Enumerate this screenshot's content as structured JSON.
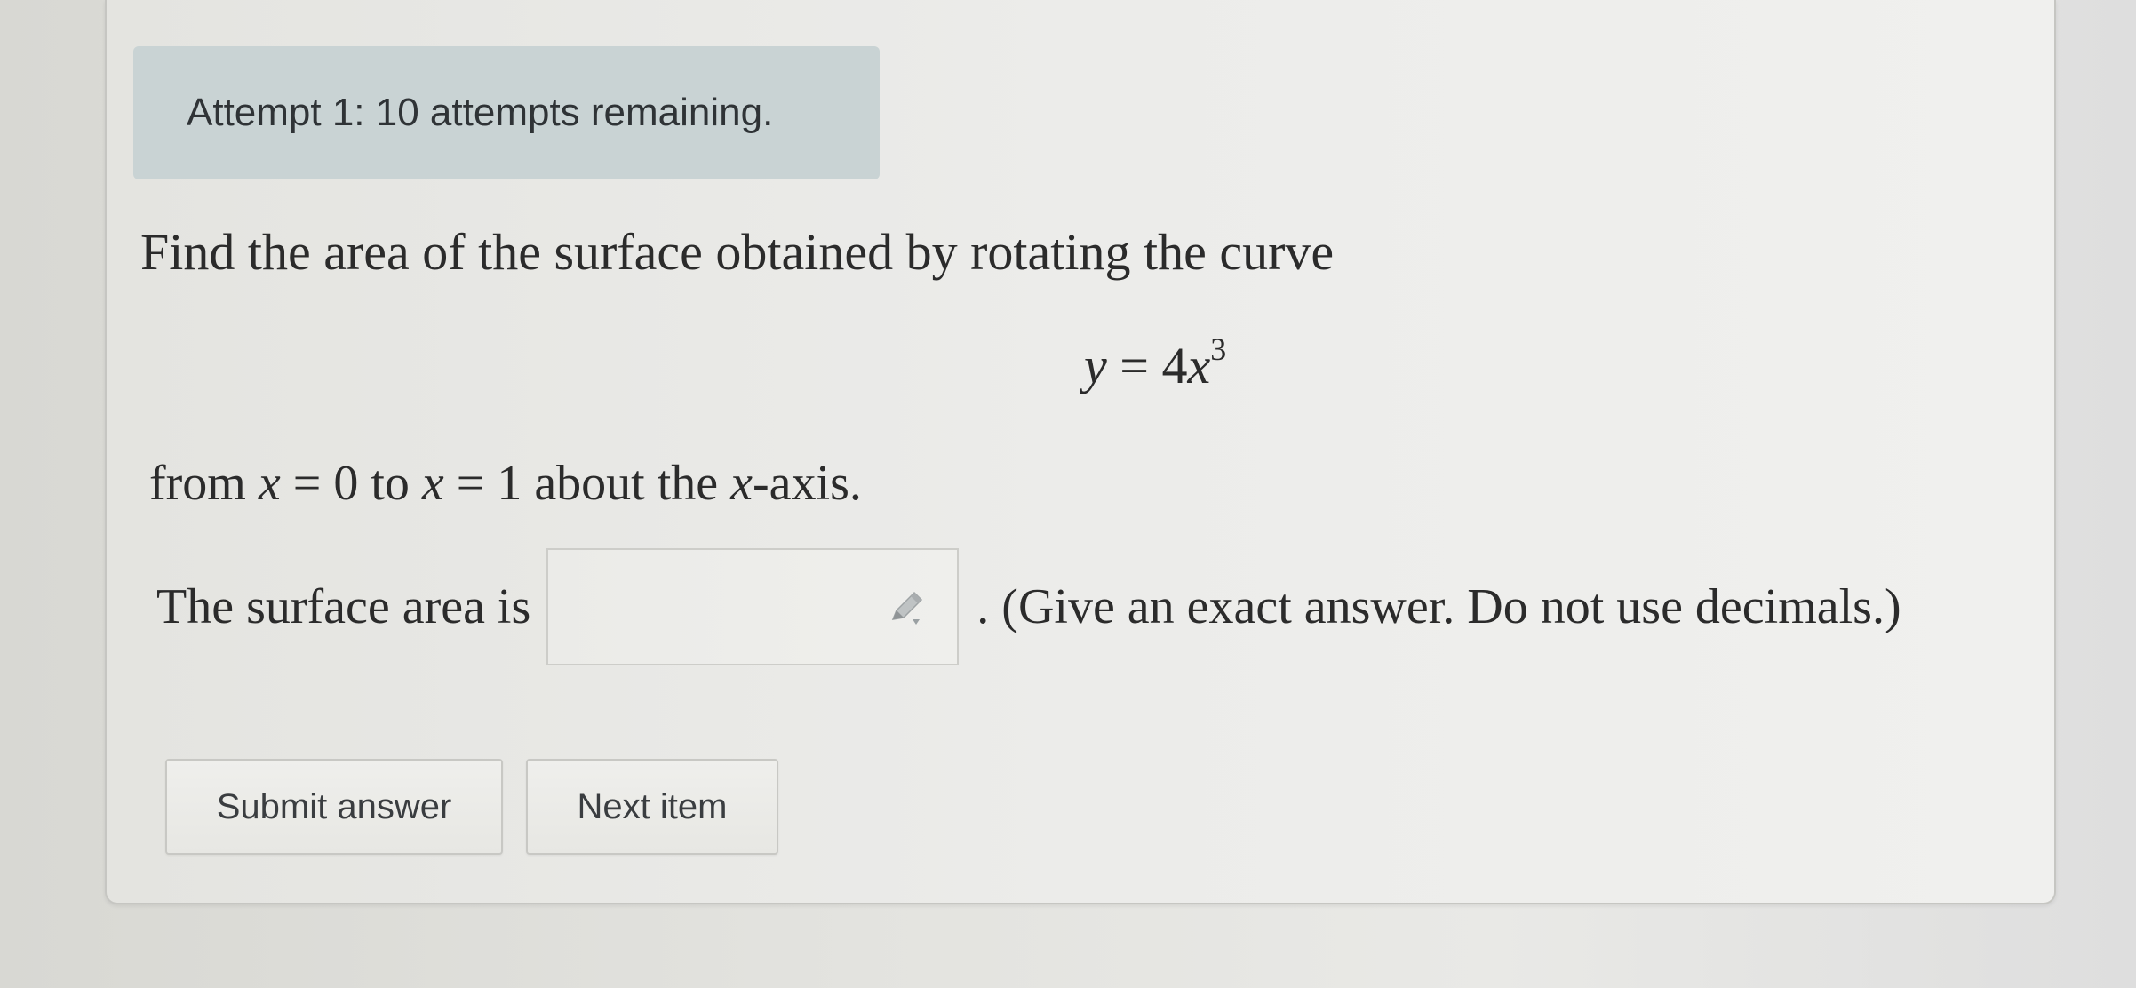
{
  "attempt": {
    "text": "Attempt 1: 10 attempts remaining."
  },
  "question": {
    "prompt": "Find the area of the surface obtained by rotating the curve",
    "equation": {
      "lhs": "y",
      "equals": "=",
      "coefficient": "4",
      "variable": "x",
      "exponent": "3"
    },
    "range": {
      "from_word": "from",
      "var1": "x",
      "eq1": "=",
      "start": "0",
      "to_word": "to",
      "var2": "x",
      "eq2": "=",
      "end": "1",
      "about_text": "about the",
      "axis_var": "x",
      "axis_suffix": "-axis."
    },
    "answer": {
      "lead_text": "The surface area is",
      "value": "",
      "trail_text": ". (Give an exact answer. Do not use decimals.)",
      "icon": "pencil-icon"
    }
  },
  "buttons": {
    "submit_label": "Submit answer",
    "next_label": "Next item"
  }
}
